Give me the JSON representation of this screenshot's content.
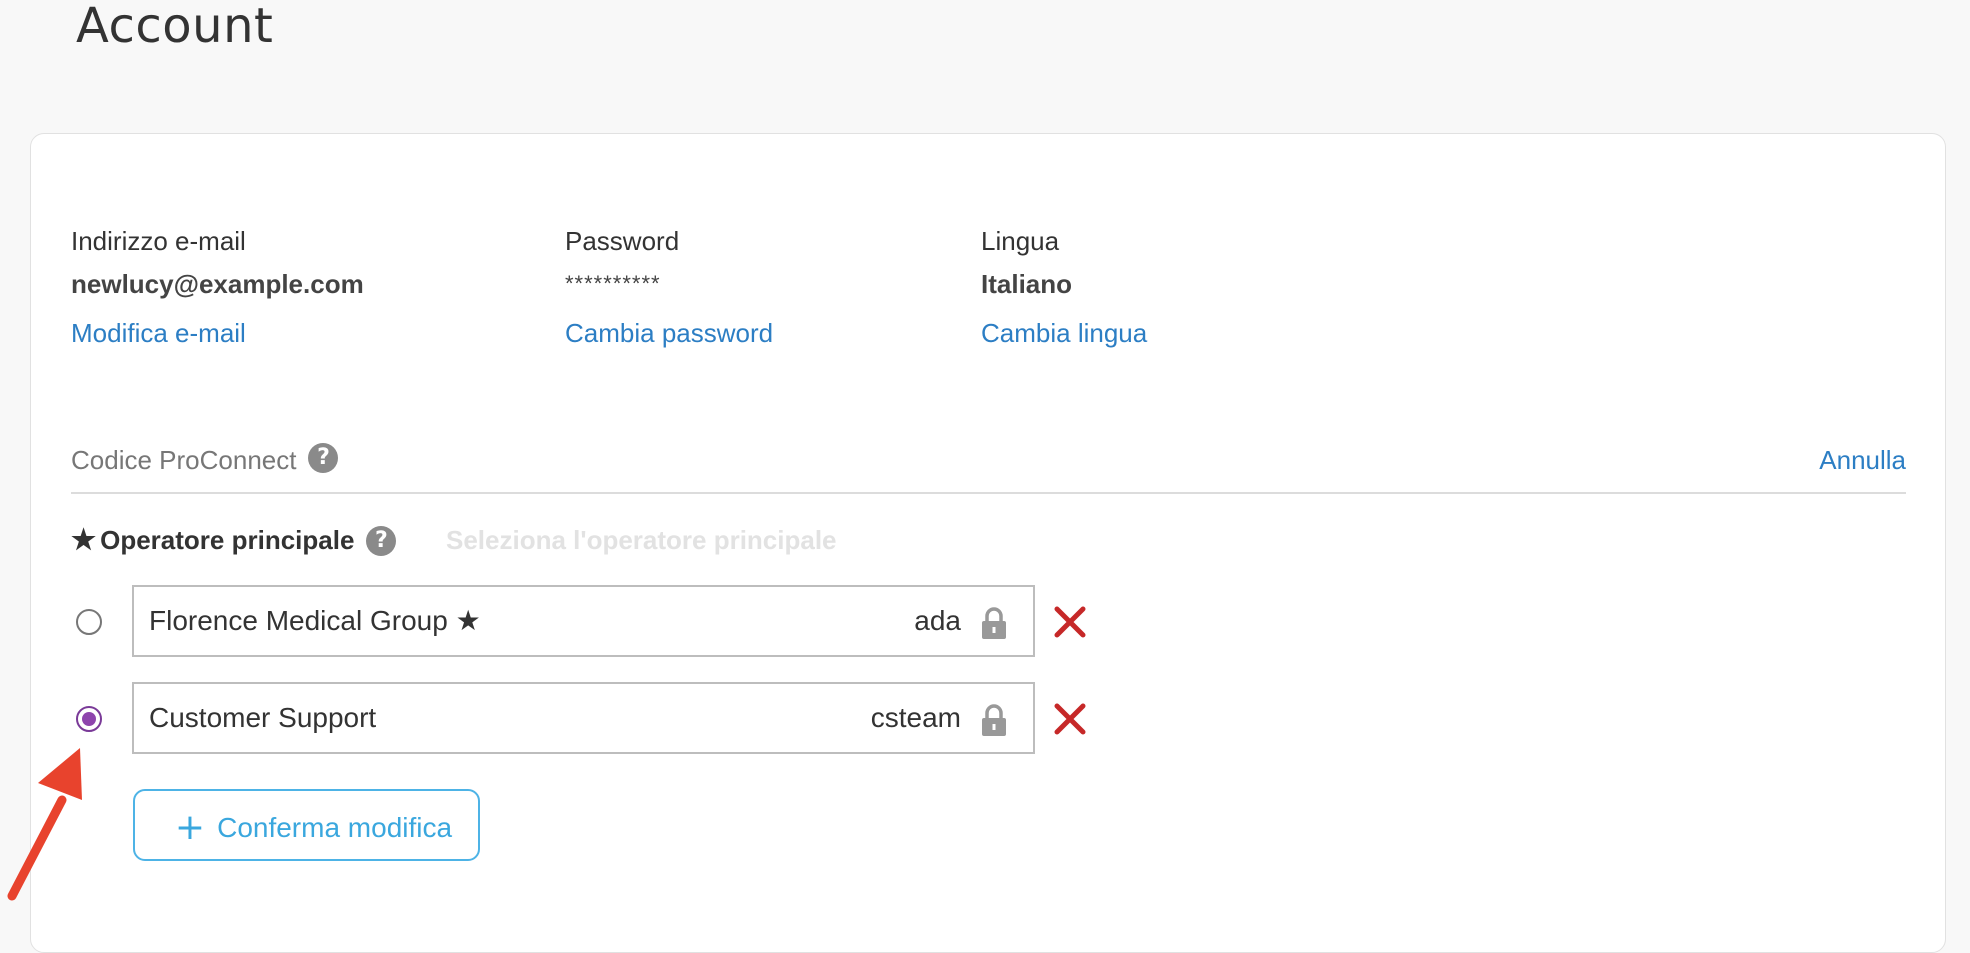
{
  "page": {
    "title": "Account"
  },
  "account": {
    "email": {
      "label": "Indirizzo e-mail",
      "value": "newlucy@example.com",
      "link": "Modifica e-mail"
    },
    "password": {
      "label": "Password",
      "value": "**********",
      "link": "Cambia password"
    },
    "language": {
      "label": "Lingua",
      "value": "Italiano",
      "link": "Cambia lingua"
    }
  },
  "proconnect": {
    "title": "Codice ProConnect",
    "help": "?",
    "cancel": "Annulla"
  },
  "operator": {
    "star": "★",
    "title": "Operatore principale",
    "help": "?",
    "hint": "Seleziona l'operatore principale",
    "items": [
      {
        "name": "Florence Medical Group ★",
        "code": "ada",
        "selected": false
      },
      {
        "name": "Customer Support",
        "code": "csteam",
        "selected": true
      }
    ],
    "confirm_icon": "+",
    "confirm": "Conferma modifica"
  },
  "colors": {
    "link": "#2c7ec4",
    "delete": "#c62828",
    "radio_selected": "#8e44ad",
    "button": "#3aa7de",
    "annotation_arrow": "#e8432d"
  }
}
